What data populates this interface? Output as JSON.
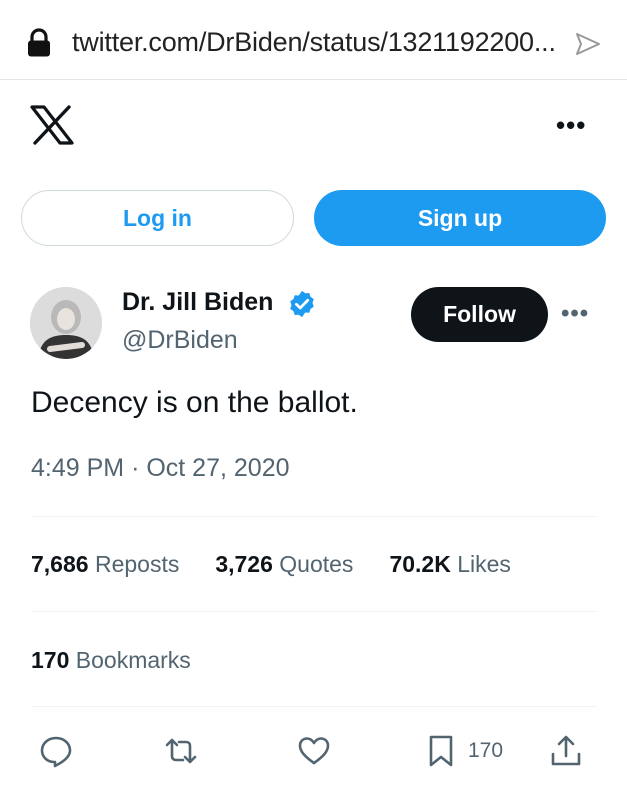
{
  "browser": {
    "url": "twitter.com/DrBiden/status/1321192200...",
    "icons": [
      "lock-icon",
      "share-arrow-icon"
    ]
  },
  "header": {
    "logo": "x-logo-icon",
    "more": "•••"
  },
  "auth": {
    "login_label": "Log in",
    "signup_label": "Sign up"
  },
  "tweet": {
    "author_name": "Dr. Jill Biden",
    "author_handle": "@DrBiden",
    "follow_label": "Follow",
    "more": "•••",
    "text": "Decency is on the ballot.",
    "time": "4:49 PM",
    "separator": "·",
    "date": "Oct 27, 2020"
  },
  "stats": {
    "reposts": {
      "num": "7,686",
      "label": "Reposts"
    },
    "quotes": {
      "num": "3,726",
      "label": "Quotes"
    },
    "likes": {
      "num": "70.2K",
      "label": "Likes"
    },
    "bookmarks": {
      "num": "170",
      "label": "Bookmarks"
    }
  },
  "actions": {
    "bookmark_count": "170"
  },
  "colors": {
    "accent": "#1d9bf0",
    "dark": "#0f1419",
    "secondary": "#536471",
    "border": "#cfd9de"
  }
}
